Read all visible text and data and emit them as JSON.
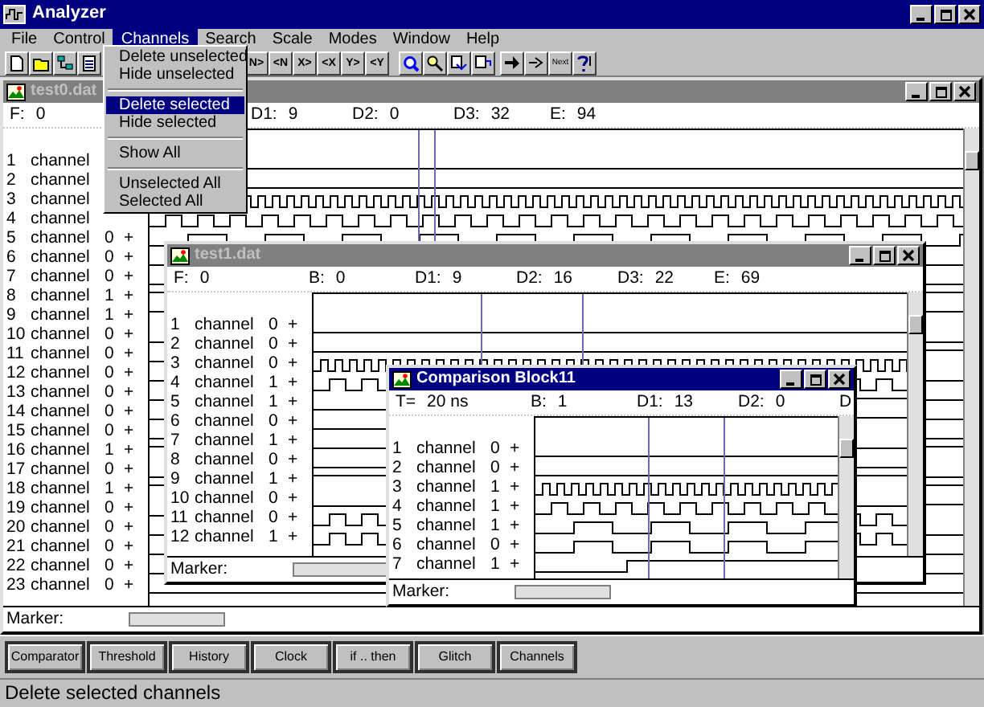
{
  "window": {
    "title": "Analyzer"
  },
  "menu_bar": [
    {
      "label": "File",
      "selected": false
    },
    {
      "label": "Control",
      "selected": false
    },
    {
      "label": "Channels",
      "selected": true
    },
    {
      "label": "Search",
      "selected": false
    },
    {
      "label": "Scale",
      "selected": false
    },
    {
      "label": "Modes",
      "selected": false
    },
    {
      "label": "Window",
      "selected": false
    },
    {
      "label": "Help",
      "selected": false
    }
  ],
  "toolbar": {
    "step_buttons": [
      "N>",
      "<N",
      "X>",
      "<X",
      "Y>",
      "<Y"
    ],
    "next_button": "Next"
  },
  "channels_menu": [
    {
      "kind": "item",
      "label": "Delete unselected",
      "selected": false
    },
    {
      "kind": "item",
      "label": "Hide unselected",
      "selected": false
    },
    {
      "kind": "separator"
    },
    {
      "kind": "item",
      "label": "Delete selected",
      "selected": true
    },
    {
      "kind": "item",
      "label": "Hide selected",
      "selected": false
    },
    {
      "kind": "separator"
    },
    {
      "kind": "item",
      "label": "Show All",
      "selected": false
    },
    {
      "kind": "separator"
    },
    {
      "kind": "item",
      "label": "Unselected All",
      "selected": false
    },
    {
      "kind": "item",
      "label": "Selected All",
      "selected": false
    }
  ],
  "windows": [
    {
      "title": "test0.dat",
      "active": false,
      "fields": [
        {
          "kind": "start",
          "label": "F:",
          "value": "0"
        },
        {
          "kind": "delta",
          "label": "D1:",
          "value": "9"
        },
        {
          "kind": "delta",
          "label": "D2:",
          "value": "0"
        },
        {
          "kind": "delta",
          "label": "D3:",
          "value": "32"
        },
        {
          "kind": "end",
          "label": "E:",
          "value": "94"
        }
      ],
      "marker": "Marker:",
      "channels": [
        {
          "number": "1",
          "name": "channel",
          "kind": "low"
        },
        {
          "number": "2",
          "name": "channel",
          "kind": "low"
        },
        {
          "number": "3",
          "name": "channel",
          "kind": "fast"
        },
        {
          "number": "4",
          "name": "channel",
          "kind": "clock"
        },
        {
          "number": "5",
          "name": "channel",
          "value": "0",
          "sign": "+",
          "kind": "slow"
        },
        {
          "number": "6",
          "name": "channel",
          "value": "0",
          "sign": "+",
          "kind": "low"
        },
        {
          "number": "7",
          "name": "channel",
          "value": "0",
          "sign": "+",
          "kind": "low"
        },
        {
          "number": "8",
          "name": "channel",
          "value": "1",
          "sign": "+",
          "kind": "high"
        },
        {
          "number": "9",
          "name": "channel",
          "value": "1",
          "sign": "+",
          "kind": "high"
        },
        {
          "number": "10",
          "name": "channel",
          "value": "0",
          "sign": "+",
          "kind": "low"
        },
        {
          "number": "11",
          "name": "channel",
          "value": "0",
          "sign": "+",
          "kind": "step"
        },
        {
          "number": "12",
          "name": "channel",
          "value": "0",
          "sign": "+",
          "kind": "low"
        },
        {
          "number": "13",
          "name": "channel",
          "value": "0",
          "sign": "+",
          "kind": "low"
        },
        {
          "number": "14",
          "name": "channel",
          "value": "0",
          "sign": "+",
          "kind": "low"
        },
        {
          "number": "15",
          "name": "channel",
          "value": "0",
          "sign": "+",
          "kind": "low"
        },
        {
          "number": "16",
          "name": "channel",
          "value": "1",
          "sign": "+",
          "kind": "high"
        },
        {
          "number": "17",
          "name": "channel",
          "value": "0",
          "sign": "+",
          "kind": "low"
        },
        {
          "number": "18",
          "name": "channel",
          "value": "1",
          "sign": "+",
          "kind": "high"
        },
        {
          "number": "19",
          "name": "channel",
          "value": "0",
          "sign": "+",
          "kind": "step"
        },
        {
          "number": "20",
          "name": "channel",
          "value": "0",
          "sign": "+",
          "kind": "low"
        },
        {
          "number": "21",
          "name": "channel",
          "value": "0",
          "sign": "+",
          "kind": "low"
        },
        {
          "number": "22",
          "name": "channel",
          "value": "0",
          "sign": "+",
          "kind": "low"
        },
        {
          "number": "23",
          "name": "channel",
          "value": "0",
          "sign": "+",
          "kind": "low"
        }
      ]
    },
    {
      "title": "test1.dat",
      "active": false,
      "fields": [
        {
          "kind": "start",
          "label": "F:",
          "value": "0"
        },
        {
          "kind": "begin",
          "label": "B:",
          "value": "0"
        },
        {
          "kind": "delta",
          "label": "D1:",
          "value": "9"
        },
        {
          "kind": "delta",
          "label": "D2:",
          "value": "16"
        },
        {
          "kind": "delta",
          "label": "D3:",
          "value": "22"
        },
        {
          "kind": "end",
          "label": "E:",
          "value": "69"
        }
      ],
      "marker": "Marker:",
      "channels": [
        {
          "number": "1",
          "name": "channel",
          "value": "0",
          "sign": "+",
          "kind": "low"
        },
        {
          "number": "2",
          "name": "channel",
          "value": "0",
          "sign": "+",
          "kind": "low"
        },
        {
          "number": "3",
          "name": "channel",
          "value": "0",
          "sign": "+",
          "kind": "fast"
        },
        {
          "number": "4",
          "name": "channel",
          "value": "1",
          "sign": "+",
          "kind": "clock"
        },
        {
          "number": "5",
          "name": "channel",
          "value": "1",
          "sign": "+",
          "kind": "step"
        },
        {
          "number": "6",
          "name": "channel",
          "value": "0",
          "sign": "+",
          "kind": "step"
        },
        {
          "number": "7",
          "name": "channel",
          "value": "1",
          "sign": "+",
          "kind": "low"
        },
        {
          "number": "8",
          "name": "channel",
          "value": "0",
          "sign": "+",
          "kind": "low"
        },
        {
          "number": "9",
          "name": "channel",
          "value": "1",
          "sign": "+",
          "kind": "high"
        },
        {
          "number": "10",
          "name": "channel",
          "value": "0",
          "sign": "+",
          "kind": "low"
        },
        {
          "number": "11",
          "name": "channel",
          "value": "0",
          "sign": "+",
          "kind": "clock"
        },
        {
          "number": "12",
          "name": "channel",
          "value": "1",
          "sign": "+",
          "kind": "clock"
        }
      ]
    },
    {
      "title": "Comparison Block11",
      "active": true,
      "fields": [
        {
          "kind": "time",
          "label": "T=",
          "value": "20 ns"
        },
        {
          "kind": "begin",
          "label": "B:",
          "value": "1"
        },
        {
          "kind": "delta",
          "label": "D1:",
          "value": "13"
        },
        {
          "kind": "delta",
          "label": "D2:",
          "value": "0"
        },
        {
          "kind": "delta",
          "label": "D"
        }
      ],
      "marker": "Marker:",
      "channels": [
        {
          "number": "1",
          "name": "channel",
          "value": "0",
          "sign": "+",
          "kind": "low"
        },
        {
          "number": "2",
          "name": "channel",
          "value": "0",
          "sign": "+",
          "kind": "low"
        },
        {
          "number": "3",
          "name": "channel",
          "value": "1",
          "sign": "+",
          "kind": "fast"
        },
        {
          "number": "4",
          "name": "channel",
          "value": "1",
          "sign": "+",
          "kind": "clock"
        },
        {
          "number": "5",
          "name": "channel",
          "value": "1",
          "sign": "+",
          "kind": "slow"
        },
        {
          "number": "6",
          "name": "channel",
          "value": "0",
          "sign": "+",
          "kind": "slow"
        },
        {
          "number": "7",
          "name": "channel",
          "value": "1",
          "sign": "+",
          "kind": "step"
        }
      ]
    }
  ],
  "function_buttons": [
    "Comparator",
    "Threshold",
    "History",
    "Clock",
    "if .. then",
    "Glitch",
    "Channels"
  ],
  "status_bar": "Delete selected channels"
}
